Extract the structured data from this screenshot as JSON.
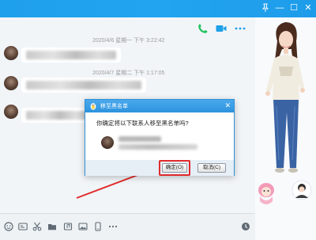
{
  "window": {
    "title": "",
    "controls": {
      "minimize": "—",
      "maximize": "☐",
      "close": "✕"
    }
  },
  "chat": {
    "timestamps": [
      "2020/4/6 星期一 下午 3:22:42",
      "2020/4/7 星期二 下午 1:17:05"
    ]
  },
  "dialog": {
    "title": "移至黑名单",
    "question": "你确定将以下联系人移至黑名单吗?",
    "ok_label": "确定(O)",
    "cancel_label": "取消(C)",
    "close_label": "✕"
  },
  "colors": {
    "titlebar": "#1fa0ec",
    "chat_bg": "#f2f5f8",
    "highlight": "#e02b2b",
    "icon_blue": "#1ea0e8",
    "icon_green": "#22c35e",
    "icon_gray": "#5f6a74"
  },
  "icons": {
    "header": [
      "phone-icon",
      "video-icon",
      "more-icon"
    ],
    "toolbar": [
      "emoji-icon",
      "gif-icon",
      "scissors-icon",
      "folder-icon",
      "music-icon",
      "image-icon",
      "phone-call-icon",
      "more-icon",
      "history-icon"
    ]
  }
}
